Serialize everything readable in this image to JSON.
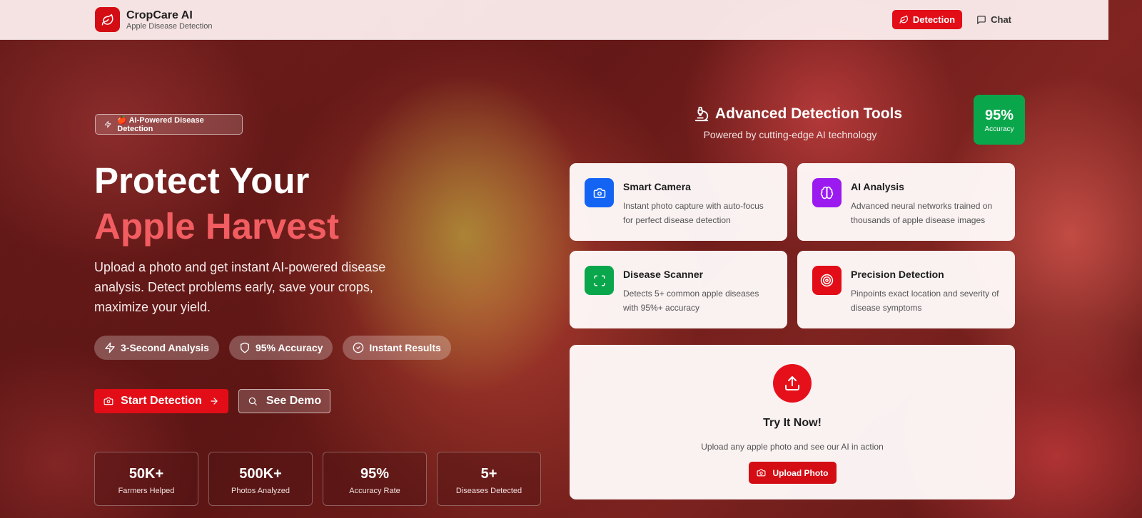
{
  "brand": {
    "title": "CropCare AI",
    "subtitle": "Apple Disease Detection",
    "logo_icon": "leaf-icon"
  },
  "nav": {
    "detection_label": "Detection",
    "chat_label": "Chat"
  },
  "hero": {
    "badge": "🍎 AI-Powered Disease Detection",
    "title_line1": "Protect Your",
    "title_line2": "Apple Harvest",
    "description": "Upload a photo and get instant AI-powered disease analysis. Detect problems early, save your crops, maximize your yield.",
    "pills": [
      {
        "label": "3-Second Analysis",
        "icon": "bolt-icon"
      },
      {
        "label": "95% Accuracy",
        "icon": "shield-icon"
      },
      {
        "label": "Instant Results",
        "icon": "check-circle-icon"
      }
    ],
    "start_label": "Start Detection",
    "demo_label": "See Demo"
  },
  "stats": [
    {
      "value": "50K+",
      "label": "Farmers Helped"
    },
    {
      "value": "500K+",
      "label": "Photos Analyzed"
    },
    {
      "value": "95%",
      "label": "Accuracy Rate"
    },
    {
      "value": "5+",
      "label": "Diseases Detected"
    }
  ],
  "tools": {
    "title": "Advanced Detection Tools",
    "subtitle": "Powered by cutting-edge AI technology",
    "accuracy_value": "95%",
    "accuracy_label": "Accuracy",
    "cards": [
      {
        "title": "Smart Camera",
        "description": "Instant photo capture with auto-focus for perfect disease detection",
        "icon": "camera-icon",
        "color": "#1464f4"
      },
      {
        "title": "AI Analysis",
        "description": "Advanced neural networks trained on thousands of apple disease images",
        "icon": "brain-icon",
        "color": "#9a1af0"
      },
      {
        "title": "Disease Scanner",
        "description": "Detects 5+ common apple diseases with 95%+ accuracy",
        "icon": "scan-icon",
        "color": "#0aa64b"
      },
      {
        "title": "Precision Detection",
        "description": "Pinpoints exact location and severity of disease symptoms",
        "icon": "target-icon",
        "color": "#e20d17"
      }
    ]
  },
  "try_it": {
    "title": "Try It Now!",
    "description": "Upload any apple photo and see our AI in action",
    "button_label": "Upload Photo"
  },
  "colors": {
    "accent_red": "#e20d17",
    "highlight_pink": "#f25d62",
    "accuracy_green": "#0aa64b"
  }
}
